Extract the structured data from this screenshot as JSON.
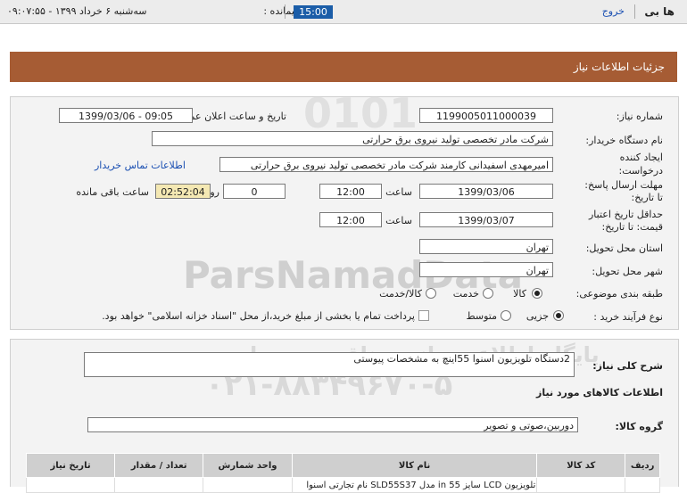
{
  "topbar": {
    "site_name": "ها بی",
    "exit_label": "خروج",
    "remaining_time_label": "زمان باقیمانده :",
    "remaining_time_value": "15:00",
    "datetime": "سه‌شنبه ۶ خرداد ۱۳۹۹ - ۰۹:۰۷:۵۵"
  },
  "page": {
    "title": "جزئیات اطلاعات نیاز"
  },
  "form": {
    "need_number_label": "شماره نیاز:",
    "need_number": "1199005011000039",
    "announce_label": "تاریخ و ساعت اعلان عمومی:",
    "announce_value": "1399/03/06 - 09:05",
    "buyer_label": "نام دستگاه خریدار:",
    "buyer_value": "شرکت مادر تخصصی تولید نیروی برق حرارتی",
    "creator_label_1": "ایجاد کننده",
    "creator_label_2": "درخواست:",
    "creator_value": "امیرمهدی اسفیدانی کارمند شرکت مادر تخصصی تولید نیروی برق حرارتی",
    "contact_link": "اطلاعات تماس خریدار",
    "deadline_label_1": "مهلت ارسال پاسخ:",
    "deadline_label_2": "تا تاریخ:",
    "deadline_date": "1399/03/06",
    "time_label": "ساعت",
    "deadline_time": "12:00",
    "days_value": "0",
    "days_label": "روز و",
    "remaining_value": "02:52:04",
    "remaining_label": "ساعت باقی مانده",
    "validity_label_1": "حداقل تاریخ اعتبار",
    "validity_label_2": "قیمت: تا تاریخ:",
    "validity_date": "1399/03/07",
    "validity_time": "12:00",
    "province_label": "استان محل تحویل:",
    "province_value": "تهران",
    "city_label": "شهر محل تحویل:",
    "city_value": "تهران",
    "category_label": "طبقه بندی موضوعی:",
    "category_options": [
      "کالا",
      "خدمت",
      "کالا/خدمت"
    ],
    "process_label": "نوع فرآیند خرید :",
    "process_options": [
      "جزیی",
      "متوسط"
    ],
    "payment_note": "پرداخت تمام یا بخشی از مبلغ خرید،از محل \"اسناد خزانه اسلامی\" خواهد بود."
  },
  "description": {
    "label": "شرح کلی نیاز:",
    "value": "2دستگاه تلویزیون اسنوا 55اینچ به مشخصات پیوستی"
  },
  "goods": {
    "section_title": "اطلاعات کالاهای مورد نیاز",
    "group_label": "گروه کالا:",
    "group_value": "دوربین،صوتی و تصویر",
    "columns": [
      "ردیف",
      "کد کالا",
      "نام کالا",
      "واحد شمارش",
      "تعداد / مقدار",
      "تاریخ نیاز"
    ],
    "row_partial": "تلویزیون LCD سایز 55 in مدل SLD55S37 نام تجارتی اسنوا"
  },
  "watermark": {
    "numbers": "0101",
    "brand": "ParsNamadData",
    "subtitle": "پایگاه اطلاع رسانی مناقصه و مزایده",
    "phone": "۰۲۱-۸۸۳۴۹۶۷۰-۵"
  }
}
